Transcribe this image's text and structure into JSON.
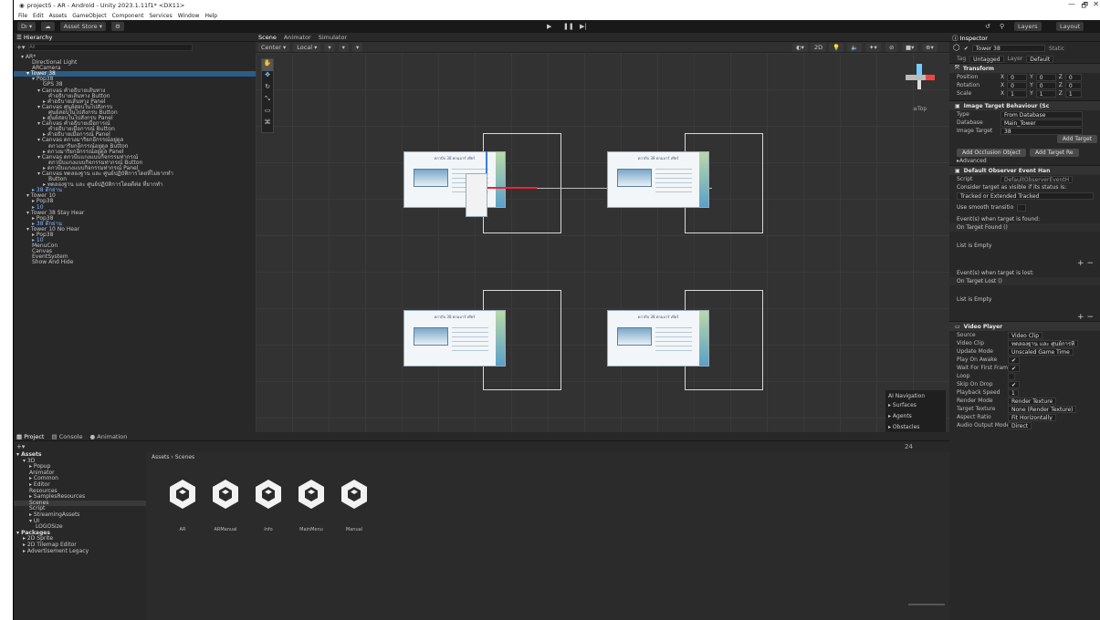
{
  "window": {
    "title": "projectS - AR - Android - Unity 2023.1.11f1* <DX11>",
    "min": "—",
    "max": "🗗",
    "close": "✕"
  },
  "menu": [
    "File",
    "Edit",
    "Assets",
    "GameObject",
    "Component",
    "Services",
    "Window",
    "Help"
  ],
  "toolbar": {
    "account": "Dı ▾",
    "cloud": "☁",
    "asset_store": "Asset Store ▾",
    "layers": "Layers",
    "layout": "Layout"
  },
  "hierarchy": {
    "tab": "Hierarchy",
    "search_placeholder": "All",
    "items": [
      {
        "t": "▾ AR*",
        "d": 1
      },
      {
        "t": "Directional Light",
        "d": 3
      },
      {
        "t": "ARCamera",
        "d": 3
      },
      {
        "t": "▾ Tower 38",
        "d": 2,
        "sel": true
      },
      {
        "t": "▾ Pop38",
        "d": 3
      },
      {
        "t": "GPS 38",
        "d": 5
      },
      {
        "t": "▾ Canvas คำอธิบายเส้นทาง",
        "d": 4
      },
      {
        "t": "คำอธิบายเส้นทาง Button",
        "d": 6
      },
      {
        "t": "▸ คำอธิบายเส้นทาง Panel",
        "d": 5
      },
      {
        "t": "▾ Canvas ศูนย์สอบในไปสังกรบ",
        "d": 4
      },
      {
        "t": "ศูนย์สอบในไปสังกรบ Button",
        "d": 6
      },
      {
        "t": "▸ ศูนย์สอบในไปสังกรบ Panel",
        "d": 5
      },
      {
        "t": "▾ Canvas คำอธิบายเมื่อการณ์",
        "d": 4
      },
      {
        "t": "คำอธิบายเมื่อการณ์ Button",
        "d": 6
      },
      {
        "t": "▸ คำอธิบายเมื่อการณ์ Panel",
        "d": 5
      },
      {
        "t": "▾ Canvas ดกวงมาริยกอีกรรณ์อยู่ดูล",
        "d": 4
      },
      {
        "t": "ดกวงมาริยกอีกรรณ์อยู่ดูล Button",
        "d": 6
      },
      {
        "t": "▸ ดกวงมาริยกอีกรรณ์อยู่ดูล Panel",
        "d": 5
      },
      {
        "t": "▾ Canvas ดกวบีบแกงแบบกิจกรรมท่ากรณ์",
        "d": 4
      },
      {
        "t": "ดกวบีบแกงแบบกิจกรรมท่ากรณ์ Button",
        "d": 6
      },
      {
        "t": "▸ ดกวบีบแกงแบบกิจกรรมท่ากรณ์ Panel",
        "d": 5
      },
      {
        "t": "▾ Canvas ทดลองฐาน และ ศูนย์ปฏิบัติการโดยที่ไม่ยากทำ",
        "d": 4
      },
      {
        "t": "Button",
        "d": 6
      },
      {
        "t": "▸ ทดลองฐาน และ ศูนย์ปฏิบัติการโดยดีต่อ ที่ยากทำ",
        "d": 5
      },
      {
        "t": "▸ 38 ตึกย่าน",
        "d": 3,
        "blue": true
      },
      {
        "t": "▾ Tower 10",
        "d": 2
      },
      {
        "t": "▸ Pop38",
        "d": 3
      },
      {
        "t": "▸ 10",
        "d": 3,
        "blue": true
      },
      {
        "t": "▾ Tower 38 Stay Hear",
        "d": 2
      },
      {
        "t": "▸ Pop38",
        "d": 3
      },
      {
        "t": "▸ 38 ตึกย่าน",
        "d": 3,
        "blue": true
      },
      {
        "t": "▾ Tower 10 No Hear",
        "d": 2
      },
      {
        "t": "▸ Pop38",
        "d": 3
      },
      {
        "t": "▸ 10",
        "d": 3,
        "blue": true
      },
      {
        "t": "MenuCon",
        "d": 3
      },
      {
        "t": "Canvas",
        "d": 3
      },
      {
        "t": "EventSystem",
        "d": 3
      },
      {
        "t": "Show And Hide",
        "d": 3
      }
    ]
  },
  "scene": {
    "tabs": [
      "Scene",
      "Animator",
      "Simulator"
    ],
    "tools": [
      "Center ▾",
      "Local ▾",
      "▾",
      "▾",
      "▾"
    ],
    "view_2d": "2D",
    "gizmo_label": "≡Top",
    "card_title": "ดกวบีบ 38 ตกมมาร์ เทียร์",
    "nav": {
      "title": "AI Navigation",
      "items": [
        "Surfaces",
        "Agents",
        "Obstacles"
      ]
    }
  },
  "inspector": {
    "tab": "Inspector",
    "object_name": "Tower 38",
    "static": "Static",
    "tag_label": "Tag",
    "tag": "Untagged",
    "layer_label": "Layer",
    "layer": "Default",
    "transform": {
      "title": "Transform",
      "position": {
        "label": "Position",
        "x": "0",
        "y": "0",
        "z": "0"
      },
      "rotation": {
        "label": "Rotation",
        "x": "0",
        "y": "0",
        "z": "0"
      },
      "scale": {
        "label": "Scale",
        "x": "1",
        "y": "1",
        "z": "1"
      }
    },
    "itb": {
      "title": "Image Target Behaviour (Sc",
      "type_label": "Type",
      "type": "From Database",
      "db_label": "Database",
      "db": "Main_Tower",
      "target_label": "Image Target",
      "target": "38",
      "add_target": "Add Target",
      "occlusion": "Add Occlusion Object",
      "add_target_re": "Add Target Re",
      "advanced": "Advanced"
    },
    "doe": {
      "title": "Default Observer Event Han",
      "script_label": "Script",
      "script": "DefaultObserverEventH",
      "consider": "Consider target as visible if its status is:",
      "status": "Tracked or Extended Tracked",
      "smooth": "Use smooth transitio",
      "found_label": "Event(s) when target is found:",
      "found": "On Target Found ()",
      "list_empty": "List is Empty",
      "lost_label": "Event(s) when target is lost:",
      "lost": "On Target Lost ()",
      "list_empty2": "List is Empty"
    },
    "vp": {
      "title": "Video Player",
      "rows": [
        {
          "l": "Source",
          "v": "Video Clip"
        },
        {
          "l": "Video Clip",
          "v": "ทดลองฐาน และ ศูนย์การที่"
        },
        {
          "l": "Update Mode",
          "v": "Unscaled Game Time"
        },
        {
          "l": "Play On Awake",
          "v": "✔"
        },
        {
          "l": "Wait For First Frame",
          "v": "✔"
        },
        {
          "l": "Loop",
          "v": ""
        },
        {
          "l": "Skip On Drop",
          "v": "✔"
        },
        {
          "l": "Playback Speed",
          "v": "1"
        },
        {
          "l": "Render Mode",
          "v": "Render Texture"
        },
        {
          "l": "Target Texture",
          "v": "None (Render Texture)"
        },
        {
          "l": "Aspect Ratio",
          "v": "Fit Horizontally"
        },
        {
          "l": "Audio Output Mode",
          "v": "Direct"
        }
      ]
    }
  },
  "project": {
    "tabs": [
      "Project",
      "Console",
      "Animation"
    ],
    "breadcrumb": "Assets › Scenes",
    "count": "24",
    "tree": [
      {
        "t": "▾ Assets",
        "d": 0,
        "b": true
      },
      {
        "t": "▾ 3D",
        "d": 1
      },
      {
        "t": "▸ Popup",
        "d": 2
      },
      {
        "t": "Animator",
        "d": 2
      },
      {
        "t": "▸ Common",
        "d": 2
      },
      {
        "t": "▸ Editor",
        "d": 2
      },
      {
        "t": "Resources",
        "d": 2
      },
      {
        "t": "▸ SamplesResources",
        "d": 2
      },
      {
        "t": "Scenes",
        "d": 2,
        "sel": true
      },
      {
        "t": "Script",
        "d": 2
      },
      {
        "t": "▸ StreamingAssets",
        "d": 2
      },
      {
        "t": "▾ UI",
        "d": 2
      },
      {
        "t": "LOGOSize",
        "d": 3
      },
      {
        "t": "▾ Packages",
        "d": 0,
        "b": true
      },
      {
        "t": "▸ 2D Sprite",
        "d": 1
      },
      {
        "t": "▸ 2D Tilemap Editor",
        "d": 1
      },
      {
        "t": "▸ Advertisement Legacy",
        "d": 1
      }
    ],
    "scenes": [
      "AR",
      "ARManual",
      "Info",
      "MainMenu",
      "Manual"
    ]
  }
}
